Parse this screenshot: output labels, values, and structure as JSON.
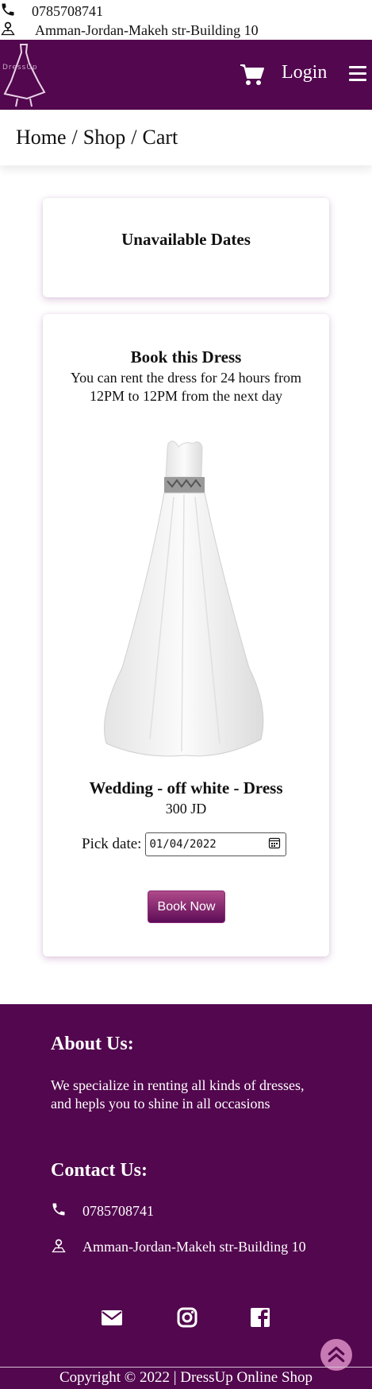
{
  "topbar": {
    "phone": "0785708741",
    "address": "Amman-Jordan-Makeh str-Building 10"
  },
  "navbar": {
    "logo_text": "DressUp",
    "login_label": "Login",
    "icons": [
      "cart-icon",
      "menu-icon"
    ]
  },
  "breadcrumb": {
    "home": "Home",
    "shop": "Shop",
    "cart": "Cart",
    "separator": "/"
  },
  "unavailable": {
    "title": "Unavailable Dates"
  },
  "booking": {
    "title": "Book this Dress",
    "description": "You can rent the dress for 24 hours from 12PM to 12PM from the next day",
    "product_name": "Wedding - off white - Dress",
    "price": "300 JD",
    "date_label": "Pick date:",
    "date_value": "01/04/2022",
    "button_label": "Book Now"
  },
  "footer": {
    "about_title": "About Us:",
    "about_text": "We specialize in renting all kinds of dresses, and hepls you to shine in all occasions",
    "contact_title": "Contact Us:",
    "phone": "0785708741",
    "address": "Amman-Jordan-Makeh str-Building 10",
    "copyright": "Copyright © 2022 | DressUp Online Shop"
  },
  "colors": {
    "brand": "#52074e",
    "button_top": "#b04a8a",
    "scroll_top": "#c77ab3"
  }
}
